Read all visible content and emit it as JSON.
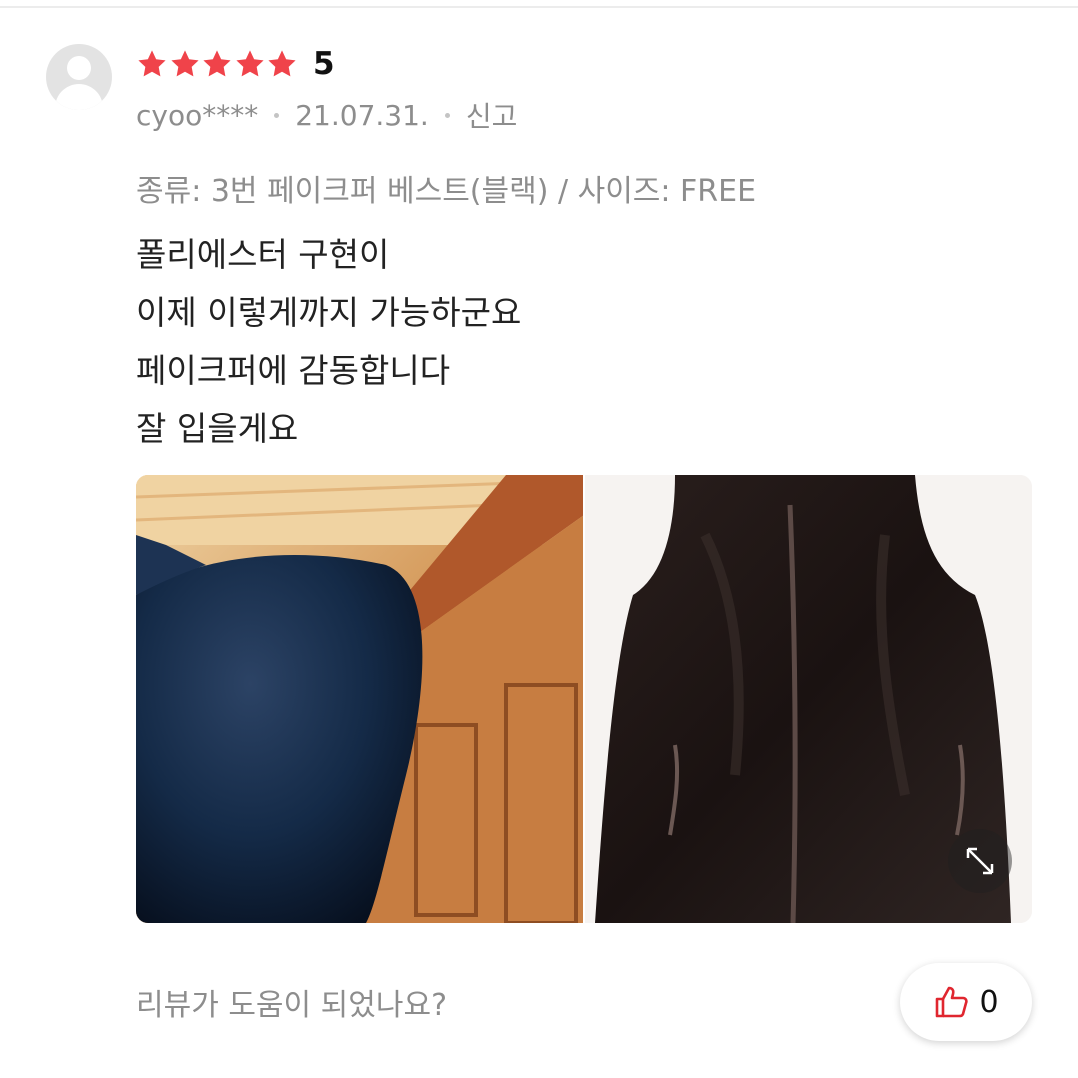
{
  "review": {
    "rating": "5",
    "rating_value": 5,
    "rating_max": 5,
    "star_color": "#f0434a",
    "author": "cyoo****",
    "date": "21.07.31.",
    "report_label": "신고",
    "option": "종류: 3번 페이크퍼 베스트(블랙) / 사이즈: FREE",
    "body_lines": [
      "폴리에스터 구현이",
      "이제 이렇게까지 가능하군요",
      "페이크퍼에 감동합니다",
      "잘 입을게요"
    ],
    "photos": [
      {
        "icon": "navy-faux-fur-photo"
      },
      {
        "icon": "black-faux-fur-vest-photo"
      }
    ],
    "expand_icon": "expand-icon"
  },
  "helpful": {
    "question": "리뷰가 도움이 되었나요?",
    "like_count": "0",
    "like_icon_color": "#e0262f"
  }
}
